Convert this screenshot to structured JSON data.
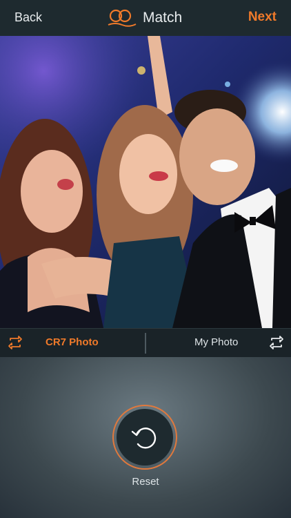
{
  "header": {
    "back_label": "Back",
    "title": "Match",
    "next_label": "Next",
    "icon": "linked-rings-icon",
    "accent": "#f07a2a"
  },
  "photo": {
    "description_icon": "group-selfie-photo"
  },
  "switch_bar": {
    "left_label": "CR7 Photo",
    "right_label": "My Photo",
    "left_icon": "swap-icon",
    "right_icon": "swap-icon"
  },
  "controls": {
    "reset_label": "Reset",
    "reset_icon": "reset-icon"
  }
}
